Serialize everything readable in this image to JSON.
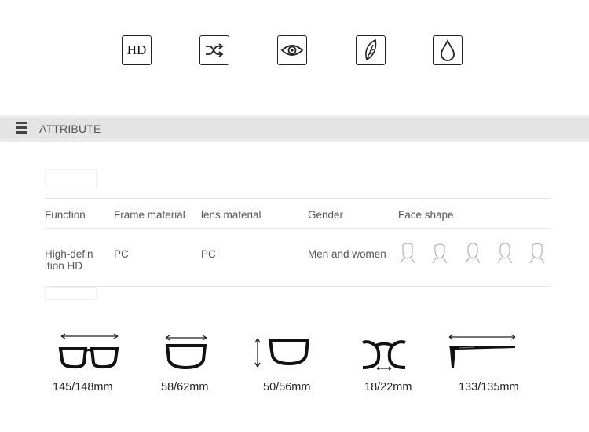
{
  "features": [
    {
      "icon": "hd-icon",
      "text": "HD"
    },
    {
      "icon": "shuffle-icon"
    },
    {
      "icon": "eye-icon"
    },
    {
      "icon": "feather-icon"
    },
    {
      "icon": "water-drop-icon"
    }
  ],
  "section": {
    "title": "ATTRIBUTE",
    "icon": "menu-icon"
  },
  "attributes": {
    "headers": [
      "Function",
      "Frame material",
      "lens material",
      "Gender",
      "Face shape"
    ],
    "function_line1": "High-defin",
    "function_line2": "ition HD",
    "frame_material": "PC",
    "lens_material": "PC",
    "gender": "Men and women",
    "face_shapes": [
      "face-shape-icon",
      "face-shape-icon",
      "face-shape-icon",
      "face-shape-icon",
      "face-shape-icon"
    ]
  },
  "dimensions": [
    {
      "label": "145/148mm",
      "icon": "frame-width-icon"
    },
    {
      "label": "58/62mm",
      "icon": "lens-width-icon"
    },
    {
      "label": "50/56mm",
      "icon": "lens-height-icon"
    },
    {
      "label": "18/22mm",
      "icon": "bridge-width-icon"
    },
    {
      "label": "133/135mm",
      "icon": "temple-length-icon"
    }
  ],
  "colors": {
    "bar": "#e4e4e4",
    "text": "#555555",
    "icon": "#222222"
  }
}
